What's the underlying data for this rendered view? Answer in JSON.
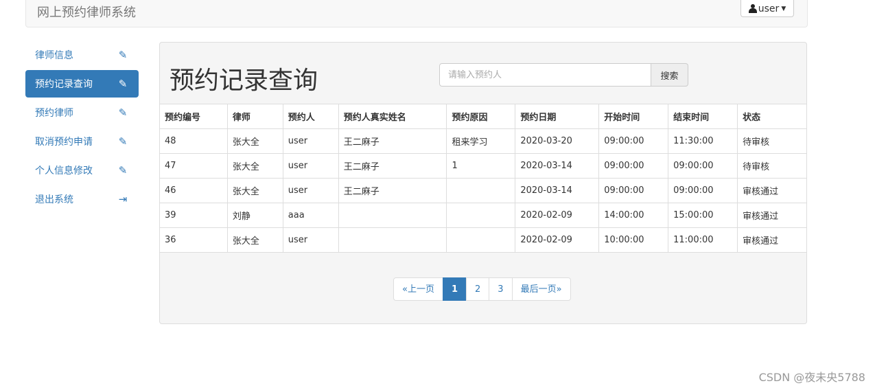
{
  "navbar": {
    "brand": "网上预约律师系统",
    "user_label": "user"
  },
  "sidebar": {
    "items": [
      {
        "label": "律师信息",
        "icon": "pencil-icon",
        "glyph": "✎",
        "active": false
      },
      {
        "label": "预约记录查询",
        "icon": "pencil-icon",
        "glyph": "✎",
        "active": true
      },
      {
        "label": "预约律师",
        "icon": "pencil-icon",
        "glyph": "✎",
        "active": false
      },
      {
        "label": "取消预约申请",
        "icon": "pencil-icon",
        "glyph": "✎",
        "active": false
      },
      {
        "label": "个人信息修改",
        "icon": "pencil-icon",
        "glyph": "✎",
        "active": false
      },
      {
        "label": "退出系统",
        "icon": "logout-icon",
        "glyph": "⇥",
        "active": false
      }
    ]
  },
  "main": {
    "title": "预约记录查询",
    "search": {
      "placeholder": "请输入预约人",
      "value": "",
      "button": "搜索"
    },
    "table": {
      "headers": [
        "预约编号",
        "律师",
        "预约人",
        "预约人真实姓名",
        "预约原因",
        "预约日期",
        "开始时间",
        "结束时间",
        "状态"
      ],
      "rows": [
        [
          "48",
          "张大全",
          "user",
          "王二麻子",
          "租来学习",
          "2020-03-20",
          "09:00:00",
          "11:30:00",
          "待审核"
        ],
        [
          "47",
          "张大全",
          "user",
          "王二麻子",
          "1",
          "2020-03-14",
          "09:00:00",
          "09:00:00",
          "待审核"
        ],
        [
          "46",
          "张大全",
          "user",
          "王二麻子",
          "",
          "2020-03-14",
          "09:00:00",
          "09:00:00",
          "审核通过"
        ],
        [
          "39",
          "刘静",
          "aaa",
          "",
          "",
          "2020-02-09",
          "14:00:00",
          "15:00:00",
          "审核通过"
        ],
        [
          "36",
          "张大全",
          "user",
          "",
          "",
          "2020-02-09",
          "10:00:00",
          "11:00:00",
          "审核通过"
        ]
      ]
    },
    "pagination": {
      "prev": "«上一页",
      "pages": [
        "1",
        "2",
        "3"
      ],
      "current": "1",
      "last": "最后一页»"
    }
  },
  "watermark": "CSDN @夜未央5788",
  "colors": {
    "primary": "#337ab7",
    "panel_bg": "#f5f5f5",
    "navbar_bg": "#f8f8f8"
  }
}
